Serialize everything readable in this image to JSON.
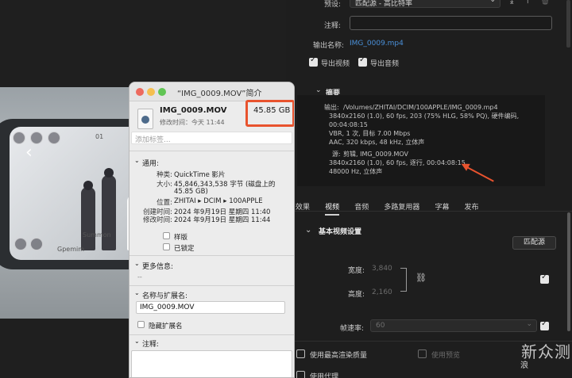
{
  "photo": {
    "phone_text_1": "01",
    "phone_text_2": "Summon",
    "phone_text_3": "Gpemim"
  },
  "export": {
    "preset_label": "预设:",
    "preset_value": "匹配源 - 高比特率",
    "comment_label": "注释:",
    "comment_value": "",
    "output_name_label": "输出名称:",
    "output_name_value": "IMG_0009.mp4",
    "export_video_label": "导出视频",
    "export_audio_label": "导出音频",
    "summary_label": "摘要",
    "output_prefix": "输出:",
    "output_lines": [
      "/Volumes/ZHITAI/DCIM/100APPLE/IMG_0009.mp4",
      "3840x2160 (1.0), 60 fps, 203 (75% HLG, 58% PQ), 硬件编码, 00:04:08:15",
      "VBR, 1 次, 目标 7.00 Mbps",
      "AAC, 320 kbps, 48 kHz, 立体声"
    ],
    "source_prefix": "源:",
    "source_lines": [
      "剪辑, IMG_0009.MOV",
      "3840x2160 (1.0), 60 fps, 逐行, 00:04:08:15",
      "48000 Hz, 立体声"
    ],
    "tabs": [
      "效果",
      "视频",
      "音频",
      "多路复用器",
      "字幕",
      "发布"
    ],
    "active_tab": "视频",
    "basic_settings_label": "基本视频设置",
    "match_source_button": "匹配源",
    "width_label": "宽度:",
    "width_value": "3,840",
    "height_label": "高度:",
    "height_value": "2,160",
    "frame_rate_label": "帧速率:",
    "frame_rate_value": "60",
    "max_render_label": "使用最高渲染质量",
    "use_preview_label": "使用预览",
    "use_proxy_label": "使用代理"
  },
  "info_window": {
    "title": "“IMG_0009.MOV”简介",
    "file_name": "IMG_0009.MOV",
    "size_display": "45.85 GB",
    "modified_short": "修改时间：今天 11:44",
    "tags_placeholder": "添加标签...",
    "general_label": "通用:",
    "kind_key": "种类:",
    "kind_value": "QuickTime 影片",
    "size_key": "大小:",
    "size_value_1": "45,846,343,538 字节 (磁盘上的",
    "size_value_2": "45.85 GB)",
    "where_key": "位置:",
    "where_value": "ZHITAI ▸ DCIM ▸ 100APPLE",
    "created_key": "创建时间:",
    "created_value": "2024 年9月19日 星期四 11:40",
    "modified_key": "修改时间:",
    "modified_value": "2024 年9月19日 星期四 11:44",
    "stationery_label": "样版",
    "locked_label": "已锁定",
    "more_info_label": "更多信息:",
    "more_info_value": "--",
    "name_ext_label": "名称与扩展名:",
    "name_value": "IMG_0009.MOV",
    "hide_ext_label": "隐藏扩展名",
    "comments_label": "注释:"
  },
  "watermark": {
    "main": "新众测",
    "sub": "浪"
  }
}
